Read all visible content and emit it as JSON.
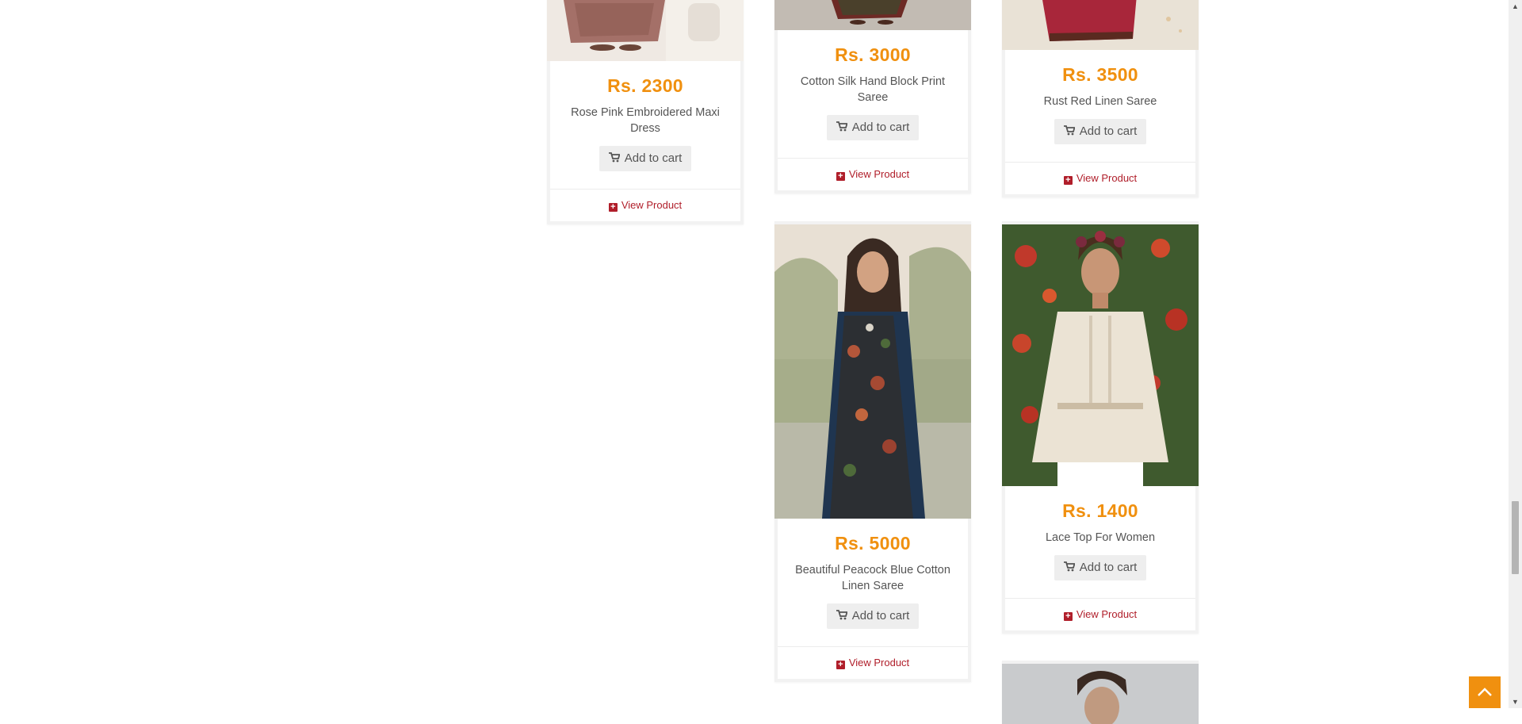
{
  "products": [
    {
      "price": "Rs. 2300",
      "name": "Rose Pink Embroidered Maxi Dress",
      "cart_label": "Add to cart",
      "view_label": "View Product"
    },
    {
      "price": "Rs. 3000",
      "name": "Cotton Silk Hand Block Print Saree",
      "cart_label": "Add to cart",
      "view_label": "View Product"
    },
    {
      "price": "Rs. 3500",
      "name": "Rust Red Linen Saree",
      "cart_label": "Add to cart",
      "view_label": "View Product"
    },
    {
      "price": "Rs. 5000",
      "name": "Beautiful Peacock Blue Cotton Linen Saree",
      "cart_label": "Add to cart",
      "view_label": "View Product"
    },
    {
      "price": "Rs. 1400",
      "name": "Lace Top For Women",
      "cart_label": "Add to cart",
      "view_label": "View Product"
    }
  ],
  "colors": {
    "price": "#f0900f",
    "view_link": "#b01e2a",
    "button_bg": "#eeeeee",
    "back_to_top": "#f0900f"
  },
  "icons": {
    "cart": "shopping-cart-icon",
    "view": "plus-square-icon",
    "back_to_top": "chevron-up-icon"
  }
}
